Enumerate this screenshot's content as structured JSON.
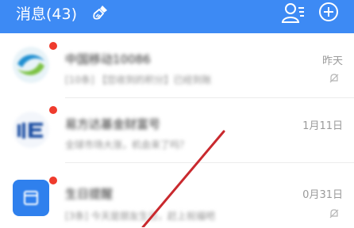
{
  "header": {
    "title": "消息(43)",
    "bg_color": "#3d8af4",
    "icons": [
      "brush-icon",
      "contacts-icon",
      "add-icon"
    ]
  },
  "messages": [
    {
      "name": "中国移动10086",
      "preview": "[10条] 【您收到的积分】已经到账",
      "time": "昨天",
      "avatar": "china-mobile-logo",
      "unread": true,
      "muted": true
    },
    {
      "name": "易方达基金财富号",
      "preview": "全球市场大涨，机会来了吗？",
      "time": "1月11日",
      "avatar": "efunds-logo",
      "unread": true,
      "muted": false
    },
    {
      "name": "生日提醒",
      "preview": "[3条] 今天是朋友生日，赶上祝福吧",
      "time": "0月31日",
      "avatar": "calendar-icon",
      "unread": true,
      "muted": true
    }
  ],
  "colors": {
    "unread_dot": "#ef3b2d",
    "avatar_blue": "#2f80ed"
  }
}
